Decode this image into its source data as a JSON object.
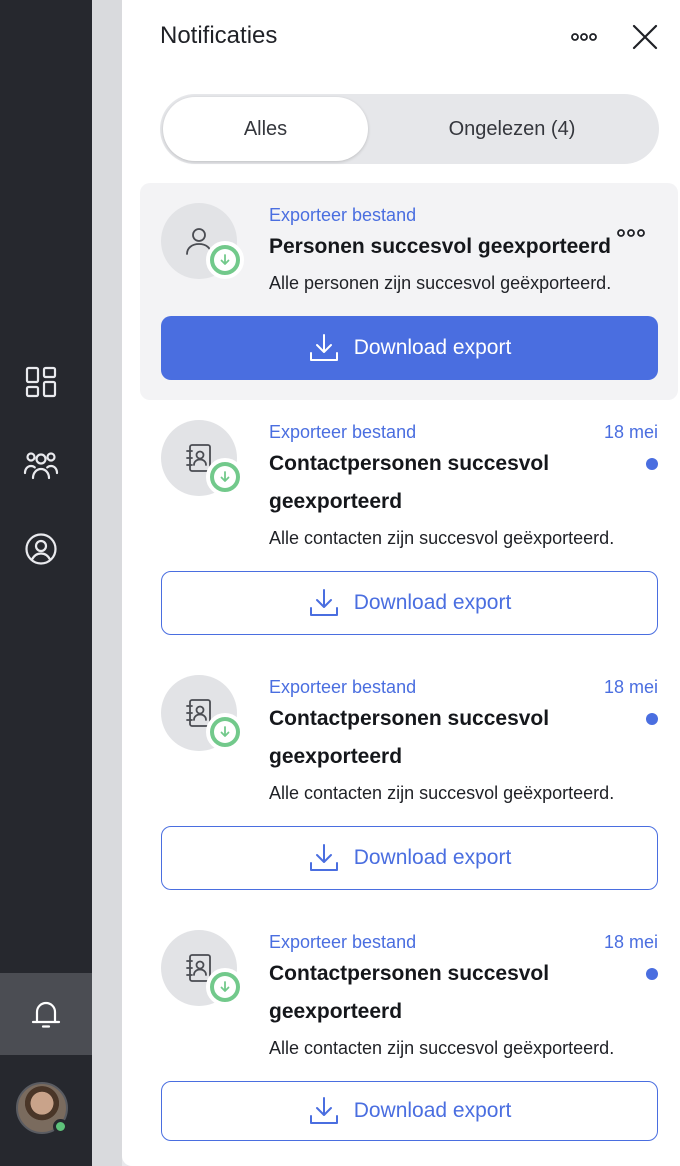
{
  "sidebar": {
    "icons": [
      "dashboard-icon",
      "users-icon",
      "account-icon",
      "bell-icon"
    ],
    "active": "bell-icon"
  },
  "panel": {
    "title": "Notificaties"
  },
  "tabs": [
    {
      "label": "Alles",
      "active": true
    },
    {
      "label": "Ongelezen (4)",
      "active": false
    }
  ],
  "notifications": [
    {
      "category": "Exporteer bestand",
      "title": "Personen succesvol geexporteerd",
      "description": "Alle personen zijn succesvol geëxporteerd.",
      "date": "",
      "unread": false,
      "icon": "person-icon",
      "button_label": "Download export",
      "button_style": "primary"
    },
    {
      "category": "Exporteer bestand",
      "title": "Contactpersonen succesvol geexporteerd",
      "description": "Alle contacten zijn succesvol geëxporteerd.",
      "date": "18 mei",
      "unread": true,
      "icon": "contact-book-icon",
      "button_label": "Download export",
      "button_style": "secondary"
    },
    {
      "category": "Exporteer bestand",
      "title": "Contactpersonen succesvol geexporteerd",
      "description": "Alle contacten zijn succesvol geëxporteerd.",
      "date": "18 mei",
      "unread": true,
      "icon": "contact-book-icon",
      "button_label": "Download export",
      "button_style": "secondary"
    },
    {
      "category": "Exporteer bestand",
      "title": "Contactpersonen succesvol geexporteerd",
      "description": "Alle contacten zijn succesvol geëxporteerd.",
      "date": "18 mei",
      "unread": true,
      "icon": "contact-book-icon",
      "button_label": "Download export",
      "button_style": "secondary"
    }
  ],
  "colors": {
    "accent": "#4a6ee0",
    "success": "#72c98b",
    "sidebar": "#26282e"
  }
}
